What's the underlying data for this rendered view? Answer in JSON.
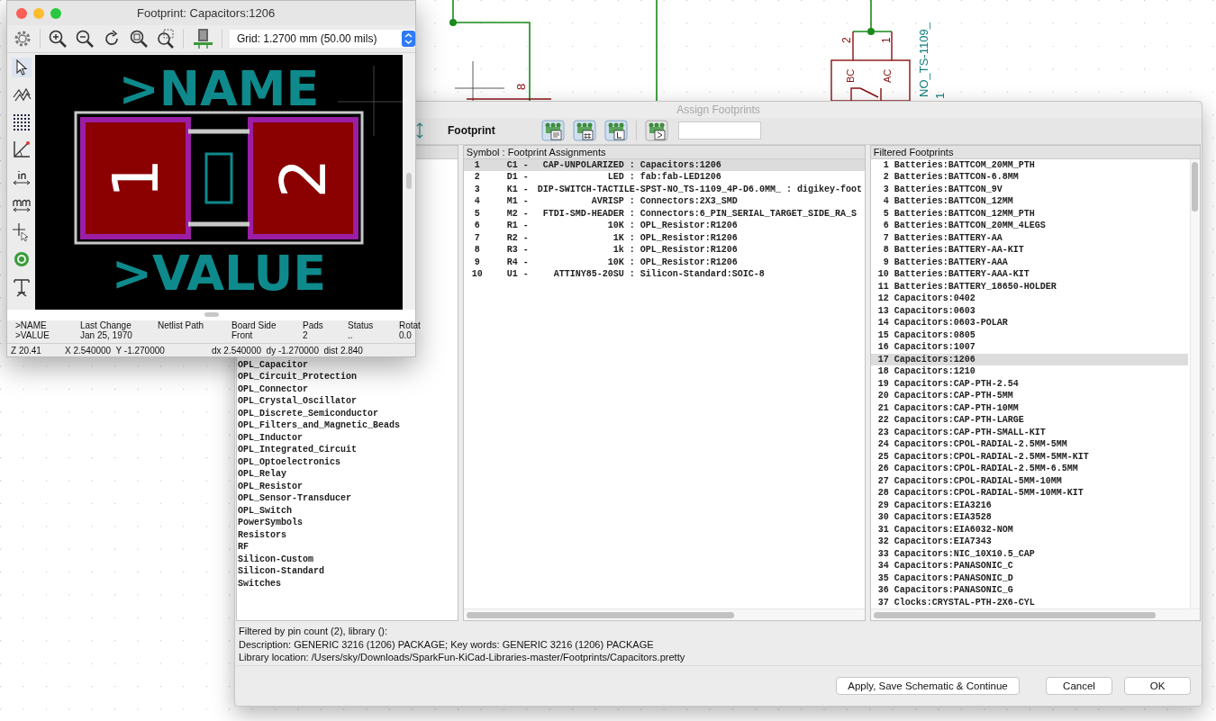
{
  "schematic": {
    "labels": [
      {
        "text": "8",
        "kind": "pin"
      },
      {
        "text": "2",
        "kind": "pin"
      },
      {
        "text": "1",
        "kind": "pin"
      },
      {
        "text": "BC",
        "kind": "pin"
      },
      {
        "text": "AC",
        "kind": "pin"
      },
      {
        "text": "NO_TS-1109_",
        "kind": "ref"
      },
      {
        "text": "1",
        "kind": "ref"
      }
    ]
  },
  "footprint_window": {
    "title": "Footprint: Capacitors:1206",
    "grid": "Grid: 1.2700 mm (50.00 mils)",
    "canvas": {
      "name": ">NAME",
      "value": ">VALUE",
      "pads": [
        "1",
        "2"
      ]
    },
    "info": [
      {
        "label": ">NAME",
        "value": ">VALUE"
      },
      {
        "label": "Last Change",
        "value": "Jan 25, 1970"
      },
      {
        "label": "Netlist Path"
      },
      {
        "label": "Board Side",
        "value": "Front"
      },
      {
        "label": "Pads",
        "value": "2"
      },
      {
        "label": "Status",
        "value": ".."
      },
      {
        "label": "Rotat",
        "value": "0.0"
      }
    ],
    "status": [
      "Z 20.41",
      "X 2.540000  Y -1.270000",
      "dx 2.540000  dy -1.270000  dist 2.840"
    ]
  },
  "dialog": {
    "title": "Assign Footprints",
    "toolbar_label": "Footprint",
    "libraries": [
      "OPL_Capacitor",
      "OPL_Circuit_Protection",
      "OPL_Connector",
      "OPL_Crystal_Oscillator",
      "OPL_Discrete_Semiconductor",
      "OPL_Filters_and_Magnetic_Beads",
      "OPL_Inductor",
      "OPL_Integrated_Circuit",
      "OPL_Optoelectronics",
      "OPL_Relay",
      "OPL_Resistor",
      "OPL_Sensor-Transducer",
      "OPL_Switch",
      "PowerSymbols",
      "Resistors",
      "RF",
      "Silicon-Custom",
      "Silicon-Standard",
      "Switches"
    ],
    "assignments": {
      "header": "Symbol : Footprint Assignments",
      "rows": [
        {
          "num": "1",
          "ref": "C1 -",
          "value": "CAP-UNPOLARIZED",
          "footprint": ": Capacitors:1206",
          "selected": true
        },
        {
          "num": "2",
          "ref": "D1 -",
          "value": "LED",
          "footprint": ": fab:fab-LED1206",
          "selected": false
        },
        {
          "num": "3",
          "ref": "K1 -",
          "value": "DIP-SWITCH-TACTILE-SPST-NO_TS-1109_4P-D6.0MM_",
          "footprint": ": digikey-foot",
          "selected": false
        },
        {
          "num": "4",
          "ref": "M1 -",
          "value": "AVRISP",
          "footprint": ": Connectors:2X3_SMD",
          "selected": false
        },
        {
          "num": "5",
          "ref": "M2 -",
          "value": "FTDI-SMD-HEADER",
          "footprint": ": Connectors:6_PIN_SERIAL_TARGET_SIDE_RA_S",
          "selected": false
        },
        {
          "num": "6",
          "ref": "R1 -",
          "value": "10K",
          "footprint": ": OPL_Resistor:R1206",
          "selected": false
        },
        {
          "num": "7",
          "ref": "R2 -",
          "value": "1K",
          "footprint": ": OPL_Resistor:R1206",
          "selected": false
        },
        {
          "num": "8",
          "ref": "R3 -",
          "value": "1k",
          "footprint": ": OPL_Resistor:R1206",
          "selected": false
        },
        {
          "num": "9",
          "ref": "R4 -",
          "value": "10K",
          "footprint": ": OPL_Resistor:R1206",
          "selected": false
        },
        {
          "num": "10",
          "ref": "U1 -",
          "value": "ATTINY85-20SU",
          "footprint": ": Silicon-Standard:SOIC-8",
          "selected": false
        }
      ]
    },
    "footprints": {
      "header": "Filtered Footprints",
      "rows": [
        {
          "num": "1",
          "name": "Batteries:BATTCOM_20MM_PTH",
          "selected": false
        },
        {
          "num": "2",
          "name": "Batteries:BATTCON-6.8MM",
          "selected": false
        },
        {
          "num": "3",
          "name": "Batteries:BATTCON_9V",
          "selected": false
        },
        {
          "num": "4",
          "name": "Batteries:BATTCON_12MM",
          "selected": false
        },
        {
          "num": "5",
          "name": "Batteries:BATTCON_12MM_PTH",
          "selected": false
        },
        {
          "num": "6",
          "name": "Batteries:BATTCON_20MM_4LEGS",
          "selected": false
        },
        {
          "num": "7",
          "name": "Batteries:BATTERY-AA",
          "selected": false
        },
        {
          "num": "8",
          "name": "Batteries:BATTERY-AA-KIT",
          "selected": false
        },
        {
          "num": "9",
          "name": "Batteries:BATTERY-AAA",
          "selected": false
        },
        {
          "num": "10",
          "name": "Batteries:BATTERY-AAA-KIT",
          "selected": false
        },
        {
          "num": "11",
          "name": "Batteries:BATTERY_18650-HOLDER",
          "selected": false
        },
        {
          "num": "12",
          "name": "Capacitors:0402",
          "selected": false
        },
        {
          "num": "13",
          "name": "Capacitors:0603",
          "selected": false
        },
        {
          "num": "14",
          "name": "Capacitors:0603-POLAR",
          "selected": false
        },
        {
          "num": "15",
          "name": "Capacitors:0805",
          "selected": false
        },
        {
          "num": "16",
          "name": "Capacitors:1007",
          "selected": false
        },
        {
          "num": "17",
          "name": "Capacitors:1206",
          "selected": true
        },
        {
          "num": "18",
          "name": "Capacitors:1210",
          "selected": false
        },
        {
          "num": "19",
          "name": "Capacitors:CAP-PTH-2.54",
          "selected": false
        },
        {
          "num": "20",
          "name": "Capacitors:CAP-PTH-5MM",
          "selected": false
        },
        {
          "num": "21",
          "name": "Capacitors:CAP-PTH-10MM",
          "selected": false
        },
        {
          "num": "22",
          "name": "Capacitors:CAP-PTH-LARGE",
          "selected": false
        },
        {
          "num": "23",
          "name": "Capacitors:CAP-PTH-SMALL-KIT",
          "selected": false
        },
        {
          "num": "24",
          "name": "Capacitors:CPOL-RADIAL-2.5MM-5MM",
          "selected": false
        },
        {
          "num": "25",
          "name": "Capacitors:CPOL-RADIAL-2.5MM-5MM-KIT",
          "selected": false
        },
        {
          "num": "26",
          "name": "Capacitors:CPOL-RADIAL-2.5MM-6.5MM",
          "selected": false
        },
        {
          "num": "27",
          "name": "Capacitors:CPOL-RADIAL-5MM-10MM",
          "selected": false
        },
        {
          "num": "28",
          "name": "Capacitors:CPOL-RADIAL-5MM-10MM-KIT",
          "selected": false
        },
        {
          "num": "29",
          "name": "Capacitors:EIA3216",
          "selected": false
        },
        {
          "num": "30",
          "name": "Capacitors:EIA3528",
          "selected": false
        },
        {
          "num": "31",
          "name": "Capacitors:EIA6032-NOM",
          "selected": false
        },
        {
          "num": "32",
          "name": "Capacitors:EIA7343",
          "selected": false
        },
        {
          "num": "33",
          "name": "Capacitors:NIC_10X10.5_CAP",
          "selected": false
        },
        {
          "num": "34",
          "name": "Capacitors:PANASONIC_C",
          "selected": false
        },
        {
          "num": "35",
          "name": "Capacitors:PANASONIC_D",
          "selected": false
        },
        {
          "num": "36",
          "name": "Capacitors:PANASONIC_G",
          "selected": false
        },
        {
          "num": "37",
          "name": "Clocks:CRYSTAL-PTH-2X6-CYL",
          "selected": false
        }
      ]
    },
    "info": [
      "Filtered by pin count (2), library ():",
      "Description: GENERIC 3216 (1206) PACKAGE;  Key words: GENERIC 3216 (1206) PACKAGE",
      "Library location: /Users/sky/Downloads/SparkFun-KiCad-Libraries-master/Footprints/Capacitors.pretty"
    ],
    "buttons": [
      "Apply, Save Schematic & Continue",
      "Cancel",
      "OK"
    ]
  }
}
